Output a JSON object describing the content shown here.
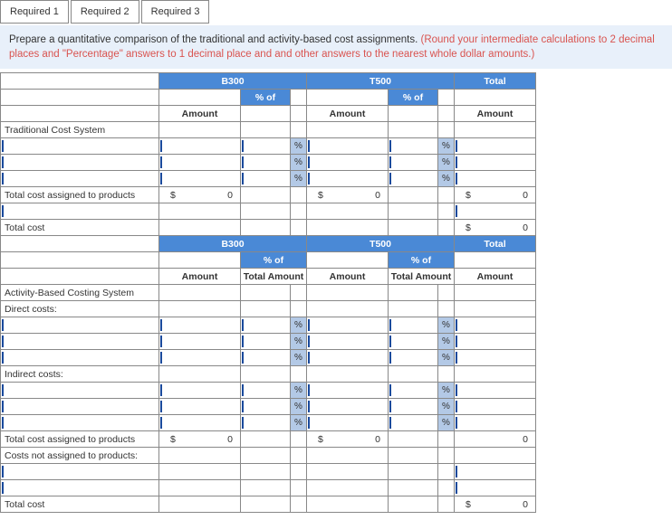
{
  "tabs": {
    "t1": "Required 1",
    "t2": "Required 2",
    "t3": "Required 3"
  },
  "instruction": {
    "black": "Prepare a quantitative comparison of the traditional and activity-based cost assignments. ",
    "red": "(Round your intermediate calculations to 2 decimal places and \"Percentage\" answers to 1 decimal place and and other answers to the nearest whole dollar amounts.)"
  },
  "hdr": {
    "b300": "B300",
    "t500": "T500",
    "total": "Total",
    "pctof": "% of",
    "amount": "Amount",
    "totalAmount": "Total Amount"
  },
  "labels": {
    "tradSystem": "Traditional Cost System",
    "totalAssigned": "Total cost assigned to products",
    "totalCost": "Total cost",
    "abcSystem": "Activity-Based Costing System",
    "directCosts": "Direct costs:",
    "indirectCosts": "Indirect costs:",
    "costsNotAssigned": "Costs not assigned to products:"
  },
  "sym": {
    "dollar": "$",
    "pct": "%",
    "zero": "0"
  }
}
